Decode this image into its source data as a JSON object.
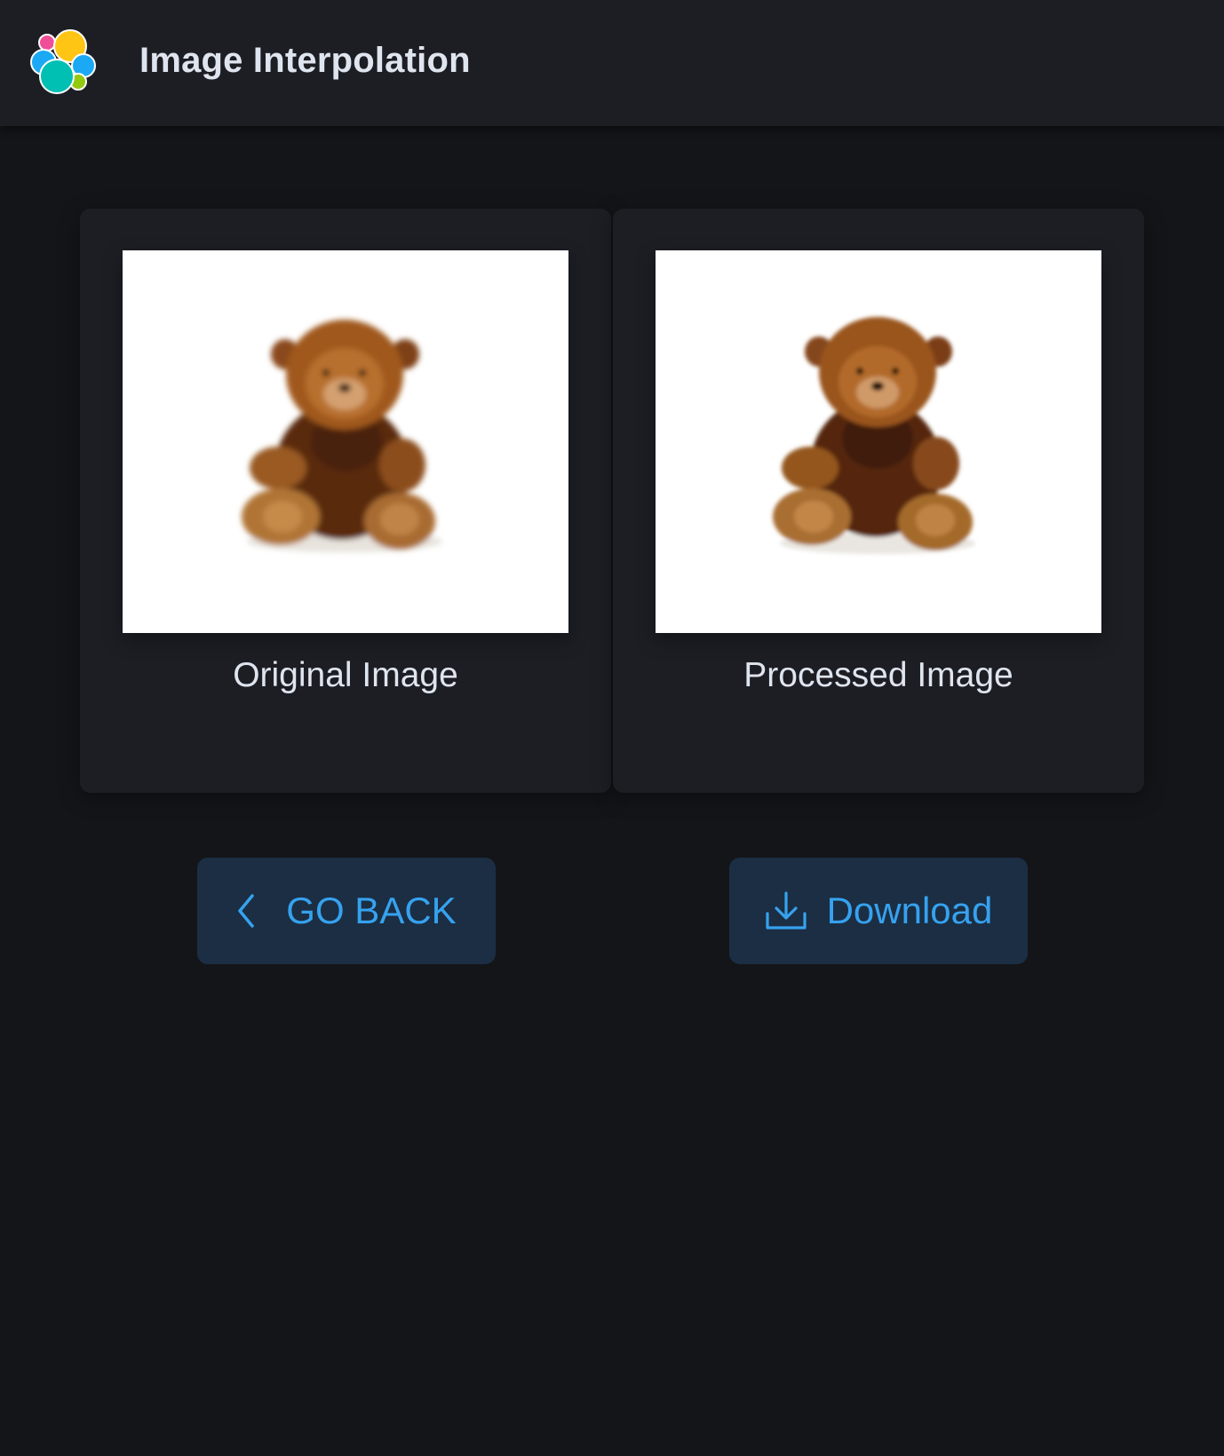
{
  "header": {
    "title": "Image Interpolation",
    "logo_icon": "app-logo-icon",
    "logo_colors": [
      "#f04e98",
      "#fec514",
      "#1ba9f5",
      "#00bfb3",
      "#93c90e"
    ]
  },
  "panels": [
    {
      "caption": "Original Image",
      "image": "teddy-bear"
    },
    {
      "caption": "Processed Image",
      "image": "teddy-bear"
    }
  ],
  "buttons": {
    "back": {
      "label": "GO BACK",
      "icon": "chevron-left-icon"
    },
    "download": {
      "label": "Download",
      "icon": "download-icon"
    }
  },
  "colors": {
    "background": "#141519",
    "panel": "#1d1e24",
    "button_bg": "#1b2e44",
    "accent": "#36a2ef",
    "text": "#dfe5ef"
  }
}
